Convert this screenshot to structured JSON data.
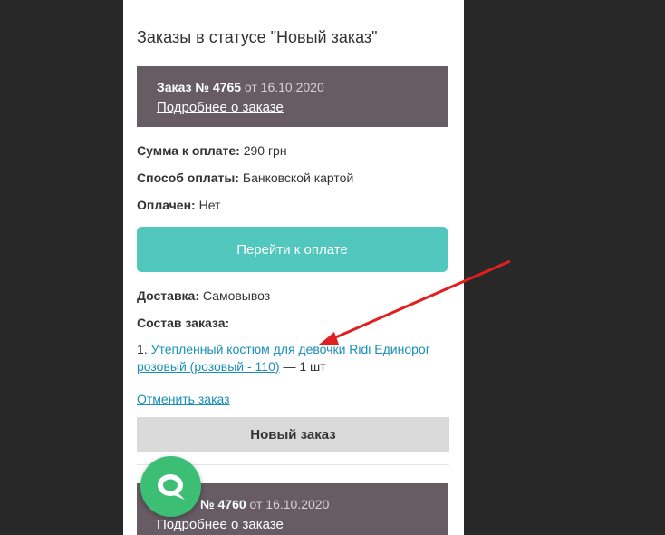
{
  "section_title": "Заказы в статусе \"Новый заказ\"",
  "orders": [
    {
      "number_label": "Заказ № 4765",
      "date_text": "от 16.10.2020",
      "details_link": "Подробнее о заказе",
      "sum_label": "Сумма к оплате:",
      "sum_value": "290 грн",
      "payment_label": "Способ оплаты:",
      "payment_value": "Банковской картой",
      "paid_label": "Оплачен:",
      "paid_value": "Нет",
      "pay_button": "Перейти к оплате",
      "delivery_label": "Доставка:",
      "delivery_value": "Самовывоз",
      "composition_label": "Состав заказа:",
      "items": [
        {
          "index": "1.",
          "name": "Утепленный костюм для девочки Ridi Единорог розовый (розовый - 110)",
          "qty": "— 1 шт"
        }
      ],
      "cancel_link": "Отменить заказ",
      "status": "Новый заказ"
    },
    {
      "number_label": "№ 4760",
      "date_text": "от 16.10.2020",
      "details_link": "Подробнее о заказе"
    }
  ],
  "colors": {
    "background": "#282828",
    "order_header": "#675b64",
    "pay_button": "#52c7bd",
    "link": "#1a8fb8",
    "status_bar": "#dadada",
    "chat_button": "#3cbf75",
    "annotation_arrow": "#e02020"
  },
  "icons": {
    "chat": "chat-bubble-icon"
  }
}
